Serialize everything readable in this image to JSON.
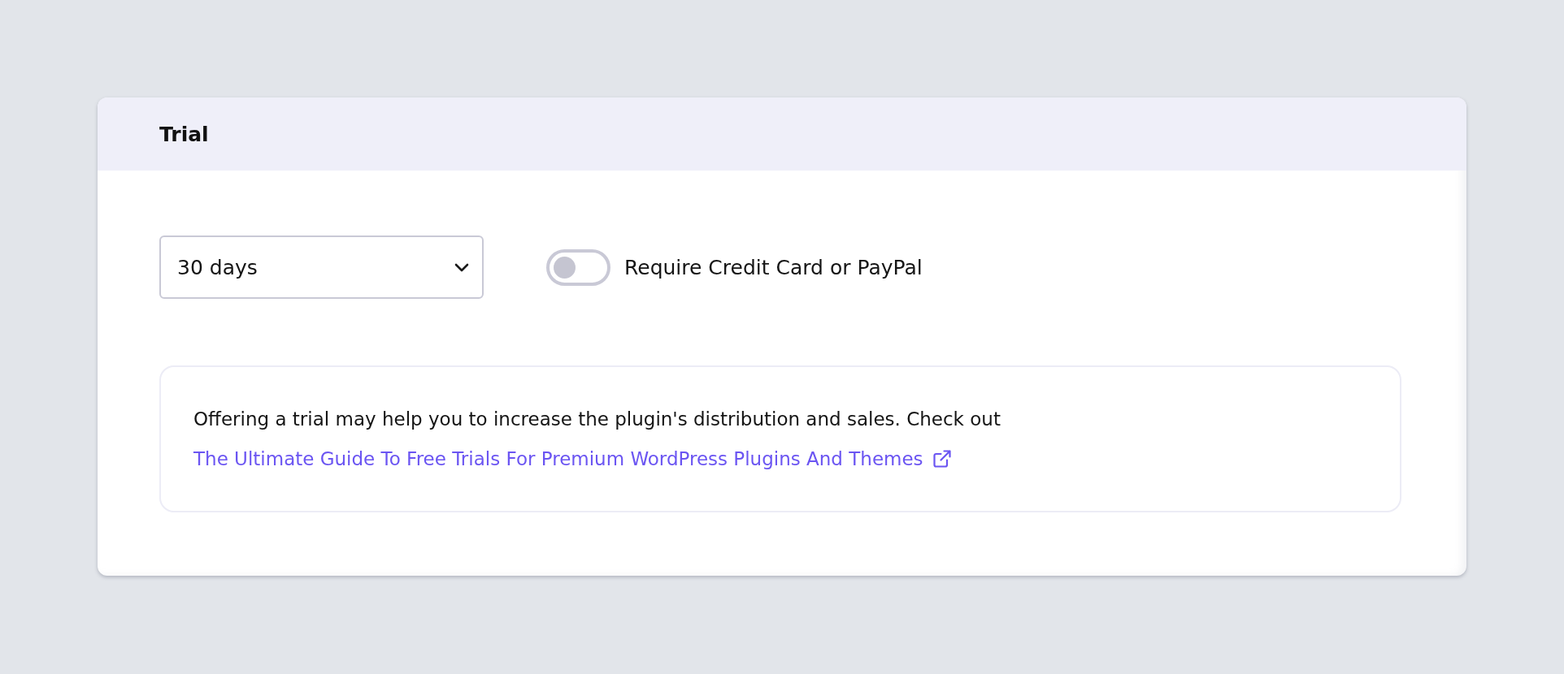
{
  "card": {
    "title": "Trial"
  },
  "trial_length": {
    "value": "30 days"
  },
  "require_payment": {
    "label": "Require Credit Card or PayPal",
    "on": false
  },
  "info": {
    "text": "Offering a trial may help you to increase the plugin's distribution and sales. Check out",
    "link": "The Ultimate Guide To Free Trials For Premium WordPress Plugins And Themes"
  }
}
